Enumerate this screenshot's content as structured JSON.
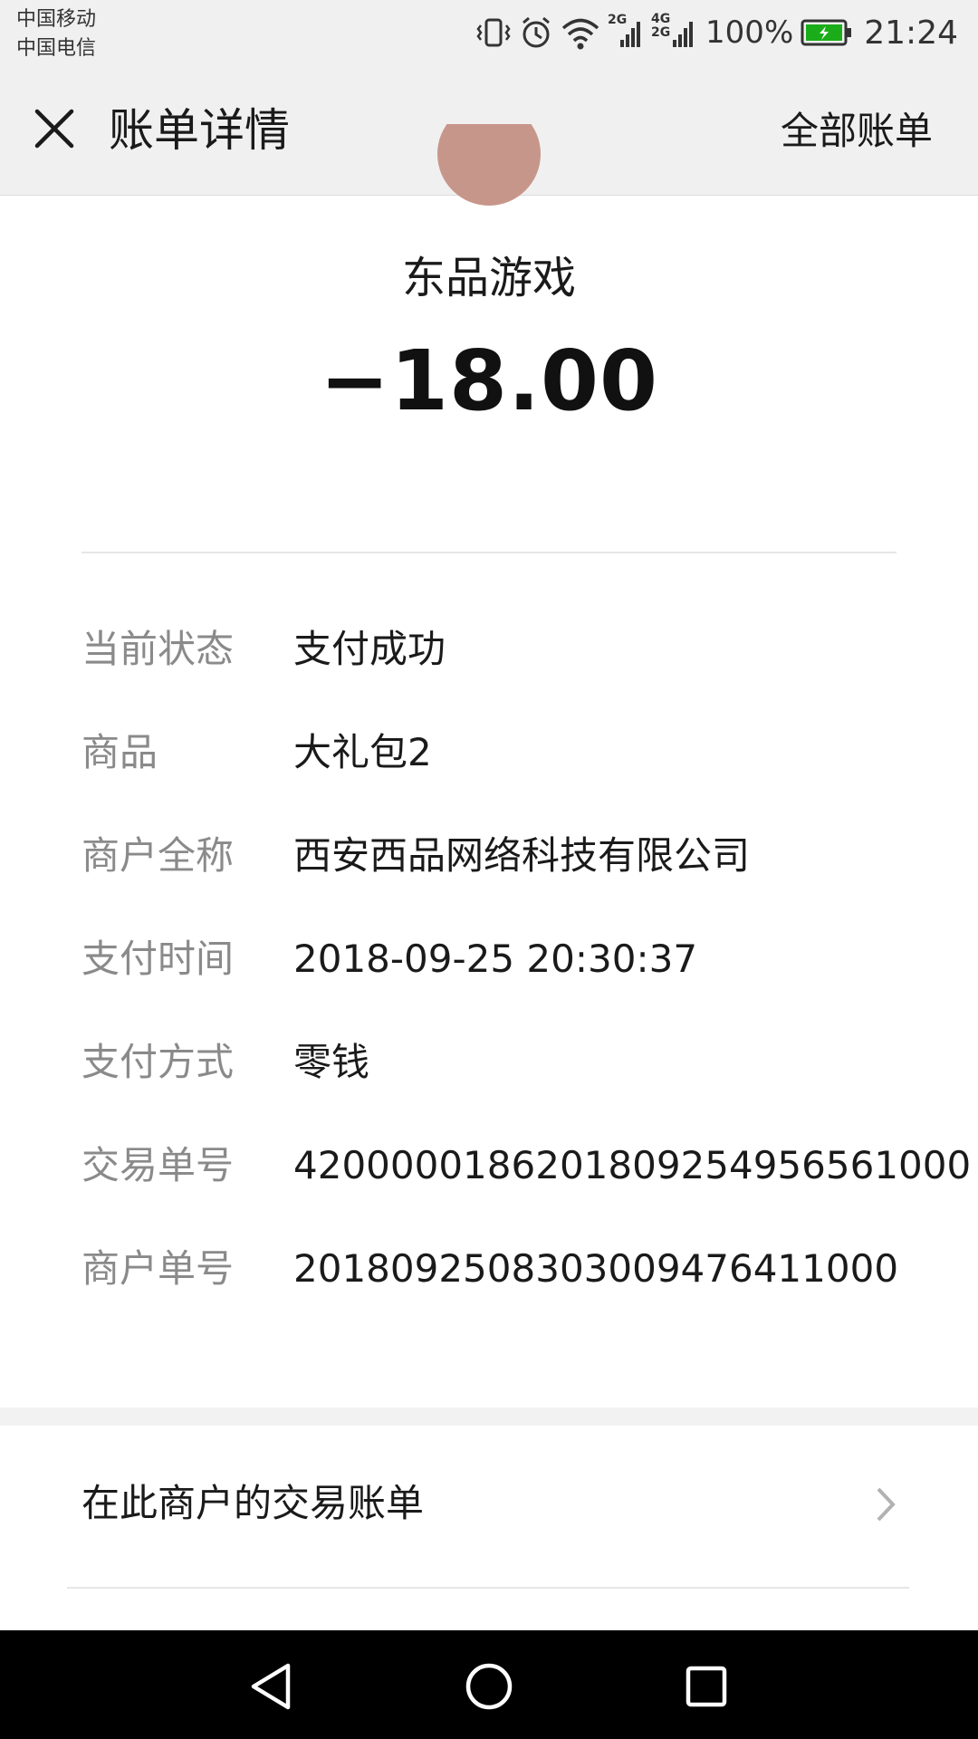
{
  "status_bar": {
    "carrier_1": "中国移动",
    "carrier_2": "中国电信",
    "network_1": "2G",
    "network_2_top": "4G",
    "network_2_bottom": "2G",
    "battery": "100%",
    "time": "21:24",
    "icons": [
      "vibrate-icon",
      "alarm-icon",
      "wifi-icon",
      "signal-icon",
      "signal-icon",
      "battery-icon"
    ],
    "battery_color": "#1aad19"
  },
  "header": {
    "title": "账单详情",
    "right_action": "全部账单"
  },
  "bill": {
    "merchant": "东品游戏",
    "amount": "−18.00"
  },
  "details": [
    {
      "label": "当前状态",
      "value": "支付成功"
    },
    {
      "label": "商品",
      "value": "大礼包2"
    },
    {
      "label": "商户全称",
      "value": "西安西品网络科技有限公司"
    },
    {
      "label": "支付时间",
      "value": "2018-09-25 20:30:37"
    },
    {
      "label": "支付方式",
      "value": "零钱"
    },
    {
      "label": "交易单号",
      "value": "4200000186201809254956561000"
    },
    {
      "label": "商户单号",
      "value": "2018092508303009476411000"
    }
  ],
  "merchant_bills": {
    "label": "在此商户的交易账单"
  },
  "nav_bar": {
    "icons": [
      "back-icon",
      "home-icon",
      "recents-icon"
    ]
  }
}
